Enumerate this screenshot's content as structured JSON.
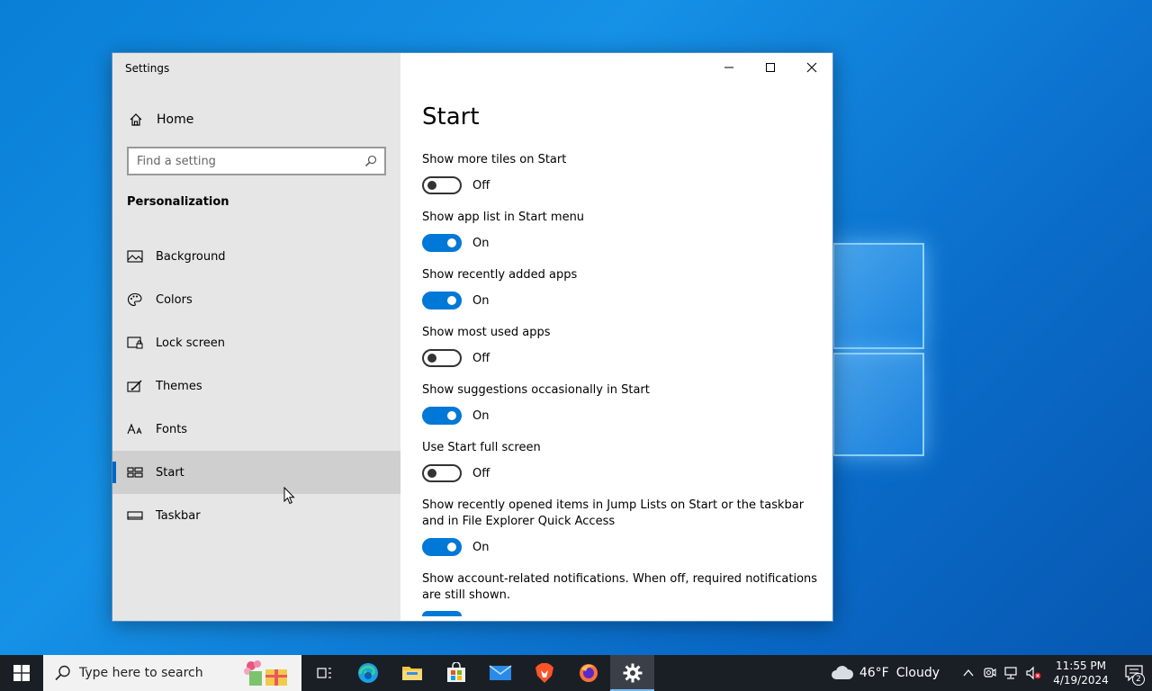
{
  "window": {
    "title": "Settings"
  },
  "sidebar": {
    "home_label": "Home",
    "search_placeholder": "Find a setting",
    "section_title": "Personalization",
    "items": [
      {
        "label": "Background",
        "icon": "picture-icon"
      },
      {
        "label": "Colors",
        "icon": "palette-icon"
      },
      {
        "label": "Lock screen",
        "icon": "lock-screen-icon"
      },
      {
        "label": "Themes",
        "icon": "themes-icon"
      },
      {
        "label": "Fonts",
        "icon": "fonts-icon"
      },
      {
        "label": "Start",
        "icon": "start-icon",
        "active": true
      },
      {
        "label": "Taskbar",
        "icon": "taskbar-icon"
      }
    ]
  },
  "content": {
    "title": "Start",
    "settings": [
      {
        "label": "Show more tiles on Start",
        "state": "Off"
      },
      {
        "label": "Show app list in Start menu",
        "state": "On"
      },
      {
        "label": "Show recently added apps",
        "state": "On"
      },
      {
        "label": "Show most used apps",
        "state": "Off"
      },
      {
        "label": "Show suggestions occasionally in Start",
        "state": "On"
      },
      {
        "label": "Use Start full screen",
        "state": "Off"
      },
      {
        "label": "Show recently opened items in Jump Lists on Start or the taskbar and in File Explorer Quick Access",
        "state": "On"
      },
      {
        "label": "Show account-related notifications. When off, required notifications are still shown.",
        "state": "On"
      }
    ]
  },
  "taskbar": {
    "search_placeholder": "Type here to search",
    "weather_temp": "46°F",
    "weather_cond": "Cloudy",
    "time": "11:55 PM",
    "date": "4/19/2024",
    "notification_count": "2"
  },
  "colors": {
    "accent": "#0078d7",
    "sidebar_bg": "#e6e6e6",
    "taskbar_bg": "#1a1f26"
  }
}
